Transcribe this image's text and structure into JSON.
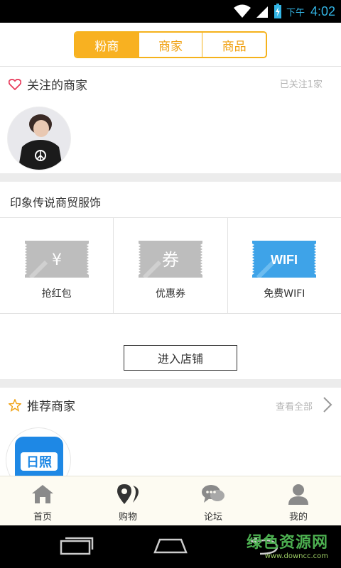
{
  "status_bar": {
    "ampm": "下午",
    "time": "4:02"
  },
  "tabs": [
    {
      "label": "粉商",
      "active": true
    },
    {
      "label": "商家",
      "active": false
    },
    {
      "label": "商品",
      "active": false
    }
  ],
  "followed": {
    "title": "关注的商家",
    "count_text": "已关注1家"
  },
  "shop": {
    "name": "印象传说商贸服饰",
    "features": [
      {
        "label": "抢红包",
        "ticket_text": "¥",
        "icon": "red-envelope-ticket-icon"
      },
      {
        "label": "优惠券",
        "ticket_text": "券",
        "icon": "coupon-ticket-icon"
      },
      {
        "label": "免费WIFI",
        "ticket_text": "WIFI",
        "icon": "wifi-ticket-icon"
      }
    ],
    "enter_label": "进入店铺"
  },
  "recommend": {
    "title": "推荐商家",
    "view_all": "查看全部",
    "logo_text": "日照"
  },
  "bottom_nav": [
    {
      "label": "首页",
      "icon": "home-icon"
    },
    {
      "label": "购物",
      "icon": "location-pin-icon"
    },
    {
      "label": "论坛",
      "icon": "chat-bubbles-icon"
    },
    {
      "label": "我的",
      "icon": "person-icon"
    }
  ],
  "watermark": {
    "main": "绿色资源网",
    "sub": "www.downcc.com"
  },
  "colors": {
    "accent": "#f8b121",
    "heart": "#e83d5d",
    "wifi_blue": "#3ea3e8",
    "ticket_gray": "#bdbdbd"
  }
}
